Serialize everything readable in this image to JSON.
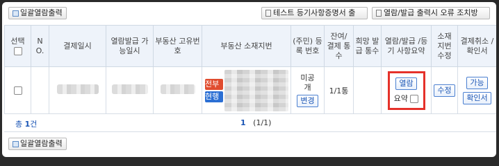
{
  "toolbar": {
    "batch_print_label": "일괄열람출력",
    "test_cert_label": "테스트 등기사항증명서 출",
    "guide_label": "열람/발급 출력시 오류 조치방"
  },
  "table": {
    "headers": {
      "select": "선택",
      "no": "N O.",
      "pay_date": "결제일시",
      "available_date": "열람발급 가능일시",
      "property_no": "부동산 고유번호",
      "address": "부동산 소재지번",
      "reg_no": "(주민) 등록 번호",
      "remaining": "잔여/ 결제 통수",
      "desired": "희망 발급 통수",
      "view_issue": "열람/발급 /등기 사항요약",
      "address_edit": "소재 지번 수정",
      "cancel": "결제취소 /확인서"
    },
    "row": {
      "tag_full": "전부",
      "tag_current": "현행",
      "reg_status": "미공개",
      "change_label": "변경",
      "count": "1/1통",
      "open_label": "열람",
      "summary_label": "요약",
      "edit_label": "수정",
      "available_label": "가능",
      "confirm_label": "확인서"
    }
  },
  "footer": {
    "total_prefix": "총",
    "total_count": "1",
    "total_suffix": "건",
    "page_current": "1",
    "page_info": "(1/1)"
  },
  "bottom": {
    "batch_print_label": "일괄열람출력"
  }
}
